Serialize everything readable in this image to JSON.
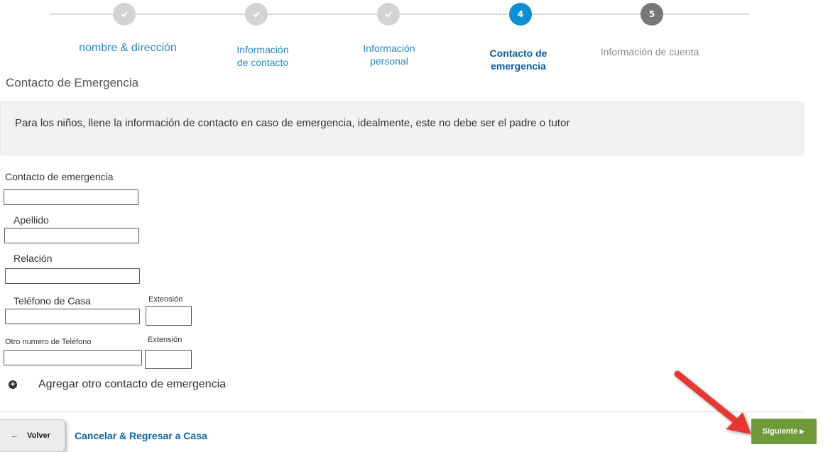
{
  "stepper": {
    "steps": [
      {
        "number": "",
        "label_line1": "nombre  & dirección",
        "label_line2": "",
        "state": "done"
      },
      {
        "number": "",
        "label_line1": "Información",
        "label_line2": "de contacto",
        "state": "done"
      },
      {
        "number": "",
        "label_line1": "Información",
        "label_line2": "personal",
        "state": "done"
      },
      {
        "number": "4",
        "label_line1": "Contacto de",
        "label_line2": "emergencia",
        "state": "active"
      },
      {
        "number": "5",
        "label_line1": "Información  de cuenta",
        "label_line2": "",
        "state": "future"
      }
    ]
  },
  "section_title": "Contacto de Emergencia",
  "info_text": "Para los niños, llene la información de contacto en caso de emergencia, idealmente, este no debe ser el padre o tutor",
  "form": {
    "emergency_contact_label": "Contacto de emergencia",
    "last_name_label": "Apellido",
    "relation_label": "Relación",
    "home_phone_label": "Teléfono de Casa",
    "extension_label_1": "Extensión",
    "other_phone_label": "Otro numero  de Teléfono",
    "extension_label_2": "Extensión"
  },
  "add_contact_label": "Agregar otro contacto de emergencia",
  "footer": {
    "back_label": "Volver",
    "cancel_label": "Cancelar & Regresar a Casa",
    "next_label": "Siguiente"
  },
  "colors": {
    "active_step": "#0b8fd3",
    "done_step": "#d3d3d3",
    "future_step": "#777777",
    "next_button": "#6e9a3a",
    "annotation_arrow": "#e53935"
  }
}
